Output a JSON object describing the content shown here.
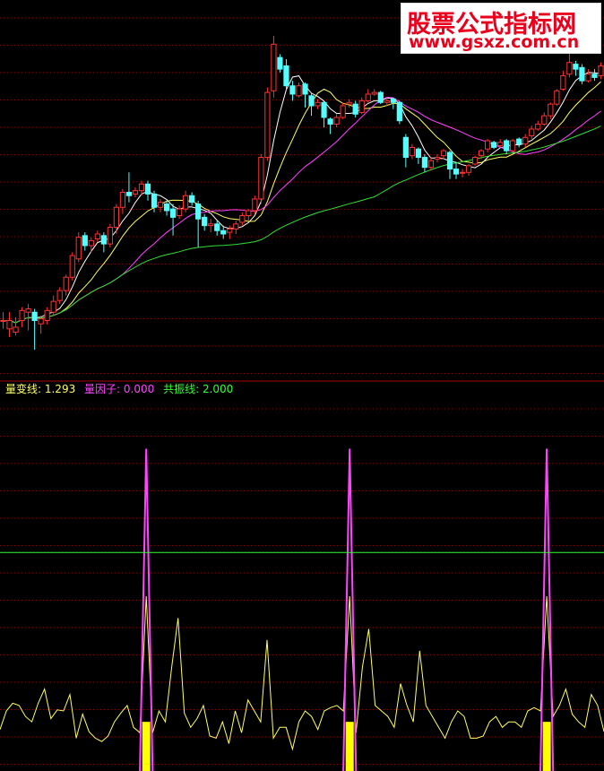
{
  "legend": {
    "volume_line": "量变线: 1.293",
    "volume_factor": "量因子: 0.000",
    "resonance_line": "共振线: 2.000"
  },
  "watermark": {
    "title": "股票公式指标网",
    "url": "www.gsxz.com.cn"
  },
  "colors": {
    "background": "#000000",
    "grid": "#8b0000",
    "up_candle": "#ff3333",
    "down_candle": "#54ffff",
    "ma_short": "#ffffff",
    "ma_mid": "#ffff66",
    "ma_long": "#ff44ff",
    "ma_longest": "#33dd33",
    "volume_line": "#ffff66",
    "volume_factor": "#ff44ff",
    "signal_bar": "#ffff00",
    "resonance_line": "#33ff33"
  },
  "chart_data": [
    {
      "type": "candlestick",
      "title": "",
      "candles": [
        [
          50,
          50,
          49,
          51
        ],
        [
          49,
          50,
          48,
          51
        ],
        [
          48.6,
          49.2,
          48.2,
          50.4
        ],
        [
          50.0,
          51.2,
          49.2,
          51.6
        ],
        [
          51.0,
          51.4,
          48.8,
          52.0
        ],
        [
          51.0,
          50.0,
          46.5,
          51.4
        ],
        [
          49.6,
          50.2,
          48.4,
          50.6
        ],
        [
          50.0,
          51.2,
          49.5,
          51.6
        ],
        [
          51.0,
          52.3,
          50.5,
          53.0
        ],
        [
          52.4,
          53.6,
          52.0,
          54.0
        ],
        [
          53.6,
          55.2,
          53.0,
          55.5
        ],
        [
          55.2,
          57.8,
          54.8,
          58.2
        ],
        [
          57.4,
          60.0,
          57.0,
          60.6
        ],
        [
          60.2,
          59.0,
          58.4,
          60.6
        ],
        [
          59.0,
          59.6,
          58.2,
          60.0
        ],
        [
          59.8,
          60.4,
          59.4,
          60.8
        ],
        [
          60.2,
          59.2,
          58.2,
          60.6
        ],
        [
          59.2,
          61.2,
          58.8,
          61.6
        ],
        [
          61.2,
          63.6,
          60.4,
          64.0
        ],
        [
          63.6,
          65.4,
          62.8,
          65.8
        ],
        [
          65.4,
          65.0,
          64.2,
          67.8
        ],
        [
          65.2,
          65.6,
          64.8,
          66.0
        ],
        [
          65.6,
          66.4,
          65.0,
          66.8
        ],
        [
          66.4,
          65.2,
          64.4,
          66.8
        ],
        [
          65.2,
          63.6,
          63.0,
          65.6
        ],
        [
          63.6,
          64.2,
          63.0,
          64.6
        ],
        [
          64.0,
          63.2,
          62.6,
          64.4
        ],
        [
          63.4,
          62.4,
          60.2,
          64.0
        ],
        [
          62.6,
          63.4,
          62.2,
          63.8
        ],
        [
          63.4,
          65.0,
          63.0,
          65.6
        ],
        [
          65.0,
          64.2,
          63.8,
          65.4
        ],
        [
          64.0,
          62.2,
          58.8,
          64.4
        ],
        [
          62.4,
          61.4,
          60.8,
          62.8
        ],
        [
          61.4,
          61.6,
          60.6,
          62.2
        ],
        [
          61.6,
          60.8,
          60.2,
          62.0
        ],
        [
          60.8,
          60.4,
          59.8,
          61.4
        ],
        [
          60.6,
          61.0,
          59.8,
          61.4
        ],
        [
          61.0,
          61.6,
          60.4,
          62.0
        ],
        [
          61.8,
          62.6,
          61.4,
          63.0
        ],
        [
          62.6,
          63.2,
          62.0,
          63.4
        ],
        [
          63.2,
          64.6,
          62.8,
          65.0
        ],
        [
          64.6,
          69.6,
          64.0,
          70.0
        ],
        [
          69.6,
          77.4,
          69.2,
          78.0
        ],
        [
          77.6,
          83.2,
          76.8,
          84.2
        ],
        [
          81.6,
          80.2,
          79.8,
          82.0
        ],
        [
          80.6,
          78.2,
          77.6,
          81.4
        ],
        [
          78.2,
          77.2,
          76.4,
          78.8
        ],
        [
          77.0,
          78.2,
          76.8,
          78.6
        ],
        [
          78.4,
          77.2,
          75.6,
          78.6
        ],
        [
          77.0,
          75.8,
          74.6,
          77.4
        ],
        [
          75.8,
          76.2,
          75.4,
          76.6
        ],
        [
          76.2,
          74.4,
          73.2,
          76.4
        ],
        [
          74.2,
          73.6,
          72.4,
          74.4
        ],
        [
          73.6,
          74.4,
          73.2,
          74.8
        ],
        [
          74.4,
          75.8,
          74.2,
          76.2
        ],
        [
          76.0,
          76.2,
          75.6,
          76.6
        ],
        [
          76.0,
          74.8,
          74.4,
          76.4
        ],
        [
          75.0,
          76.4,
          74.8,
          76.8
        ],
        [
          76.4,
          77.2,
          76.2,
          77.8
        ],
        [
          77.2,
          77.4,
          77.0,
          77.8
        ],
        [
          77.4,
          76.2,
          76.0,
          77.6
        ],
        [
          76.2,
          76.4,
          75.8,
          76.8
        ],
        [
          76.6,
          76.2,
          75.4,
          76.8
        ],
        [
          76.2,
          74.0,
          73.6,
          76.4
        ],
        [
          72.0,
          69.6,
          68.4,
          72.4
        ],
        [
          69.8,
          70.8,
          69.4,
          71.2
        ],
        [
          70.6,
          69.6,
          68.8,
          70.8
        ],
        [
          69.6,
          68.4,
          67.8,
          70.0
        ],
        [
          68.4,
          69.2,
          68.0,
          69.6
        ],
        [
          69.4,
          69.6,
          69.0,
          70.0
        ],
        [
          69.8,
          70.4,
          69.4,
          70.6
        ],
        [
          70.2,
          68.2,
          67.0,
          70.4
        ],
        [
          68.2,
          67.6,
          67.0,
          69.0
        ],
        [
          67.8,
          67.8,
          67.2,
          68.2
        ],
        [
          67.8,
          68.6,
          67.4,
          68.8
        ],
        [
          68.8,
          69.6,
          68.6,
          69.8
        ],
        [
          69.8,
          70.4,
          69.4,
          70.6
        ],
        [
          70.6,
          71.6,
          70.2,
          71.8
        ],
        [
          71.4,
          70.8,
          70.6,
          71.6
        ],
        [
          71.0,
          71.4,
          70.8,
          71.8
        ],
        [
          71.6,
          70.4,
          70.0,
          71.8
        ],
        [
          70.4,
          71.6,
          70.2,
          71.8
        ],
        [
          71.8,
          71.2,
          70.8,
          72.0
        ],
        [
          71.2,
          72.0,
          70.8,
          72.4
        ],
        [
          72.2,
          73.0,
          71.8,
          73.4
        ],
        [
          73.0,
          73.6,
          72.8,
          74.0
        ],
        [
          73.6,
          74.6,
          73.4,
          75.0
        ],
        [
          74.6,
          76.0,
          74.2,
          76.2
        ],
        [
          76.0,
          77.6,
          75.8,
          77.8
        ],
        [
          77.8,
          79.4,
          77.6,
          80.0
        ],
        [
          79.6,
          81.0,
          79.2,
          83.4
        ],
        [
          80.8,
          80.2,
          79.4,
          81.2
        ],
        [
          80.4,
          78.8,
          78.4,
          80.8
        ],
        [
          78.8,
          79.6,
          78.6,
          80.2
        ],
        [
          79.6,
          79.2,
          78.8,
          80.2
        ],
        [
          79.4,
          80.6,
          79.0,
          81.0
        ]
      ],
      "ma_periods": [
        5,
        10,
        20,
        60
      ]
    },
    {
      "type": "line",
      "title": "",
      "series_names": [
        "量变线",
        "量因子",
        "共振线"
      ],
      "volume_line": [
        0.45,
        0.55,
        0.3,
        0.6,
        0.4,
        0.45,
        0.35,
        0.75,
        0.55,
        0.4,
        0.55,
        0.38,
        0.3,
        0.4,
        0.65,
        0.5,
        0.35,
        0.2,
        0.45,
        0.7,
        0.6,
        0.45,
        0.35,
        0.6,
        0.4,
        0.3,
        0.45,
        0.5,
        0.75,
        0.7,
        0.4,
        0.55,
        0.6,
        0.35,
        0.5,
        0.45,
        0.3,
        0.55,
        0.7,
        0.65,
        0.4,
        0.45,
        0.5,
        0.3,
        0.45,
        0.4,
        0.35,
        0.5,
        0.6,
        0.4,
        0.3,
        0.55,
        0.45,
        0.6,
        0.7,
        0.5,
        0.35,
        0.25,
        0.45,
        0.6,
        0.7,
        0.5,
        0.4,
        0.35,
        0.55,
        0.45,
        0.3,
        0.6,
        0.5,
        0.4,
        0.35,
        0.45,
        0.55,
        0.4,
        0.3,
        0.5,
        0.6,
        0.45,
        0.5,
        0.4,
        0.35,
        0.45,
        0.6,
        0.5,
        0.4,
        0.55,
        0.65,
        0.45,
        0.35,
        0.5,
        0.4,
        0.45,
        0.6,
        0.5,
        0.4,
        0.45
      ],
      "volume_line_overrides": {
        "0": 0.38,
        "2": 0.62,
        "4": 0.5,
        "6": 0.62,
        "8": 0.48,
        "9": 0.56,
        "11": 0.7,
        "13": 0.52,
        "14": 0.36,
        "15": 0.3,
        "16": 0.27,
        "17": 0.32,
        "19": 0.53,
        "21": 0.4,
        "22": 0.35,
        "24": 0.35,
        "25": 0.55,
        "27": 0.95,
        "28": 1.4,
        "29": 0.53,
        "31": 0.48,
        "33": 0.32,
        "34": 0.3,
        "36": 0.25,
        "38": 0.35,
        "40": 0.55,
        "42": 1.2,
        "44": 0.4,
        "46": 0.2,
        "47": 0.45,
        "48": 0.55,
        "49": 0.5,
        "50": 0.38,
        "52": 0.58,
        "54": 0.55,
        "57": 0.95,
        "58": 1.3,
        "60": 0.55,
        "63": 0.8,
        "64": 0.6,
        "66": 1.1,
        "68": 0.5,
        "69": 0.4,
        "70": 0.3,
        "72": 0.55,
        "73": 0.5,
        "75": 0.3,
        "76": 0.32,
        "78": 0.5,
        "80": 0.45,
        "82": 0.4,
        "83": 0.55,
        "84": 0.58,
        "86": 0.3,
        "87": 0.5,
        "88": 0.6,
        "89": 0.75,
        "90": 0.52,
        "92": 0.4,
        "93": 0.7,
        "94": 0.6,
        "95": 0.36
      },
      "signals": [
        {
          "index": 23,
          "peak": 2.95,
          "line_value": 1.6,
          "bar": 0.45
        },
        {
          "index": 55,
          "peak": 2.95,
          "line_value": 1.6,
          "bar": 0.45
        },
        {
          "index": 86,
          "peak": 2.95,
          "line_value": 1.6,
          "bar": 0.45
        }
      ],
      "resonance_level": 2.0,
      "ylim": [
        0,
        3.2
      ]
    }
  ]
}
